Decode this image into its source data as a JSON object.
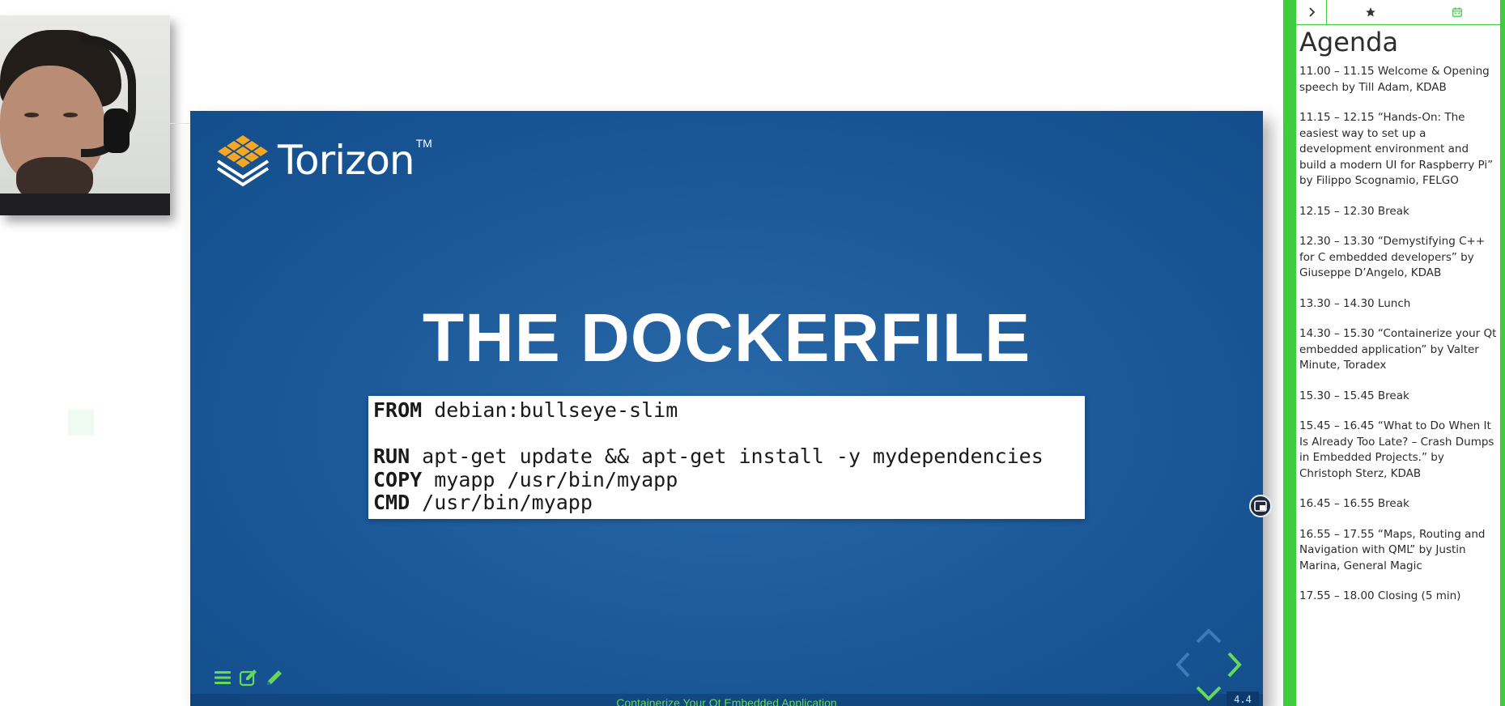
{
  "slide": {
    "logo_text": "Torizon",
    "logo_tm": "TM",
    "title": "THE DOCKERFILE",
    "code": [
      {
        "kw": "FROM",
        "text": "debian:bullseye-slim"
      },
      {
        "kw": "",
        "text": ""
      },
      {
        "kw": "RUN",
        "text": "apt-get update && apt-get install -y mydependencies"
      },
      {
        "kw": "COPY",
        "text": "myapp /usr/bin/myapp"
      },
      {
        "kw": "CMD",
        "text": "/usr/bin/myapp"
      }
    ],
    "footer_title": "Containerize Your Qt Embedded Application",
    "page_number": "4.4"
  },
  "icons": {
    "menu": "menu-icon",
    "edit": "edit-icon",
    "pencil": "pencil-icon",
    "nav_up": "arrow-up-icon",
    "nav_left": "arrow-left-icon",
    "nav_right": "arrow-right-icon",
    "nav_down": "arrow-down-icon",
    "pip": "picture-in-picture-icon",
    "tab_collapse": "chevron-right-icon",
    "tab_star": "star-icon",
    "tab_calendar": "calendar-icon"
  },
  "colors": {
    "accent_green": "#3fcc3f",
    "slide_blue": "#1d5b9b",
    "logo_orange": "#f5a623"
  },
  "sidebar": {
    "title": "Agenda",
    "items": [
      "11.00 – 11.15 Welcome & Opening speech by Till Adam, KDAB",
      "11.15 – 12.15 “Hands-On: The easiest way to set up a development environment and build a modern UI for Raspberry Pi” by Filippo Scognamio, FELGO",
      "12.15 – 12.30 Break",
      "12.30 – 13.30 “Demystifying C++ for C embedded developers” by Giuseppe D’Angelo, KDAB",
      "13.30 – 14.30 Lunch",
      "14.30 – 15.30 “Containerize your Qt embedded application” by Valter Minute, Toradex",
      "15.30 – 15.45 Break",
      "15.45 – 16.45 “What to Do When It Is Already Too Late? – Crash Dumps in Embedded Projects.” by Christoph Sterz, KDAB",
      "16.45 – 16.55 Break",
      "16.55 – 17.55 “Maps, Routing and Navigation with QML” by Justin Marina, General Magic",
      "17.55 – 18.00 Closing (5 min)"
    ]
  }
}
